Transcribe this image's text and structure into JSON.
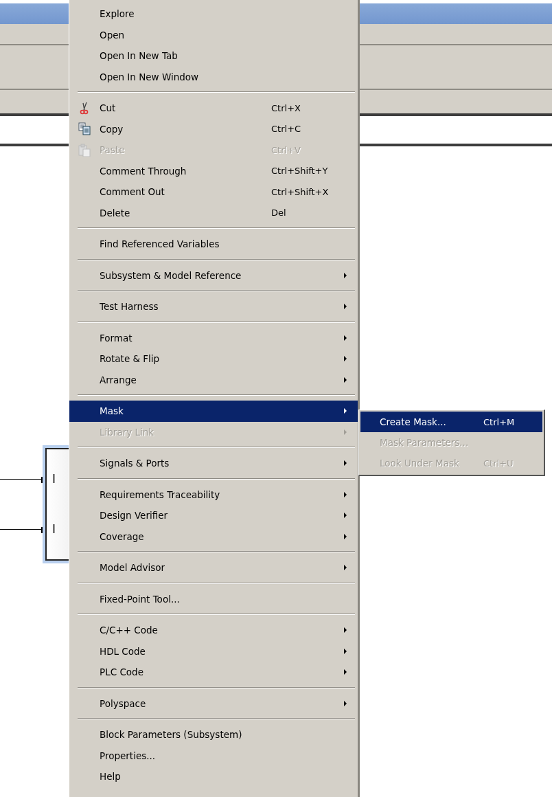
{
  "diagram": {
    "block": {
      "ports": [
        {
          "label": "I"
        },
        {
          "label": "I"
        }
      ],
      "selected": true
    }
  },
  "menu": {
    "items": [
      {
        "kind": "item",
        "label": "Explore",
        "disabled": false,
        "submenu": false,
        "selected": false
      },
      {
        "kind": "item",
        "label": "Open",
        "disabled": false,
        "submenu": false,
        "selected": false
      },
      {
        "kind": "item",
        "label": "Open In New Tab",
        "disabled": false,
        "submenu": false,
        "selected": false
      },
      {
        "kind": "item",
        "label": "Open In New Window",
        "disabled": false,
        "submenu": false,
        "selected": false
      },
      {
        "kind": "separator"
      },
      {
        "kind": "cut",
        "label": "Cut",
        "shortcut": "Ctrl+X",
        "disabled": false,
        "submenu": false,
        "selected": false
      },
      {
        "kind": "copy",
        "label": "Copy",
        "shortcut": "Ctrl+C",
        "disabled": false,
        "submenu": false,
        "selected": false
      },
      {
        "kind": "paste",
        "label": "Paste",
        "shortcut": "Ctrl+V",
        "disabled": true,
        "submenu": false,
        "selected": false
      },
      {
        "kind": "item",
        "label": "Comment Through",
        "shortcut": "Ctrl+Shift+Y",
        "disabled": false,
        "submenu": false,
        "selected": false
      },
      {
        "kind": "item",
        "label": "Comment Out",
        "shortcut": "Ctrl+Shift+X",
        "disabled": false,
        "submenu": false,
        "selected": false
      },
      {
        "kind": "item",
        "label": "Delete",
        "shortcut": "Del",
        "disabled": false,
        "submenu": false,
        "selected": false
      },
      {
        "kind": "separator"
      },
      {
        "kind": "item",
        "label": "Find Referenced Variables",
        "disabled": false,
        "submenu": false,
        "selected": false
      },
      {
        "kind": "separator"
      },
      {
        "kind": "item",
        "label": "Subsystem & Model Reference",
        "disabled": false,
        "submenu": true,
        "selected": false
      },
      {
        "kind": "separator"
      },
      {
        "kind": "item",
        "label": "Test Harness",
        "disabled": false,
        "submenu": true,
        "selected": false
      },
      {
        "kind": "separator"
      },
      {
        "kind": "item",
        "label": "Format",
        "disabled": false,
        "submenu": true,
        "selected": false
      },
      {
        "kind": "item",
        "label": "Rotate & Flip",
        "disabled": false,
        "submenu": true,
        "selected": false
      },
      {
        "kind": "item",
        "label": "Arrange",
        "disabled": false,
        "submenu": true,
        "selected": false
      },
      {
        "kind": "separator"
      },
      {
        "kind": "item",
        "label": "Mask",
        "disabled": false,
        "submenu": true,
        "selected": true
      },
      {
        "kind": "item",
        "label": "Library Link",
        "disabled": true,
        "submenu": true,
        "selected": false
      },
      {
        "kind": "separator"
      },
      {
        "kind": "item",
        "label": "Signals & Ports",
        "disabled": false,
        "submenu": true,
        "selected": false
      },
      {
        "kind": "separator"
      },
      {
        "kind": "item",
        "label": "Requirements Traceability",
        "disabled": false,
        "submenu": true,
        "selected": false
      },
      {
        "kind": "item",
        "label": "Design Verifier",
        "disabled": false,
        "submenu": true,
        "selected": false
      },
      {
        "kind": "item",
        "label": "Coverage",
        "disabled": false,
        "submenu": true,
        "selected": false
      },
      {
        "kind": "separator"
      },
      {
        "kind": "item",
        "label": "Model Advisor",
        "disabled": false,
        "submenu": true,
        "selected": false
      },
      {
        "kind": "separator"
      },
      {
        "kind": "item",
        "label": "Fixed-Point Tool...",
        "disabled": false,
        "submenu": false,
        "selected": false
      },
      {
        "kind": "separator"
      },
      {
        "kind": "item",
        "label": "C/C++ Code",
        "disabled": false,
        "submenu": true,
        "selected": false
      },
      {
        "kind": "item",
        "label": "HDL Code",
        "disabled": false,
        "submenu": true,
        "selected": false
      },
      {
        "kind": "item",
        "label": "PLC Code",
        "disabled": false,
        "submenu": true,
        "selected": false
      },
      {
        "kind": "separator"
      },
      {
        "kind": "item",
        "label": "Polyspace",
        "disabled": false,
        "submenu": true,
        "selected": false
      },
      {
        "kind": "separator"
      },
      {
        "kind": "item",
        "label": "Block Parameters (Subsystem)",
        "disabled": false,
        "submenu": false,
        "selected": false
      },
      {
        "kind": "item",
        "label": "Properties...",
        "disabled": false,
        "submenu": false,
        "selected": false
      },
      {
        "kind": "item",
        "label": "Help",
        "disabled": false,
        "submenu": false,
        "selected": false
      }
    ]
  },
  "submenu": {
    "items": [
      {
        "label": "Create Mask...",
        "shortcut": "Ctrl+M",
        "disabled": false,
        "selected": true
      },
      {
        "label": "Mask Parameters...",
        "disabled": true,
        "selected": false
      },
      {
        "label": "Look Under Mask",
        "shortcut": "Ctrl+U",
        "disabled": true,
        "selected": false
      }
    ]
  }
}
